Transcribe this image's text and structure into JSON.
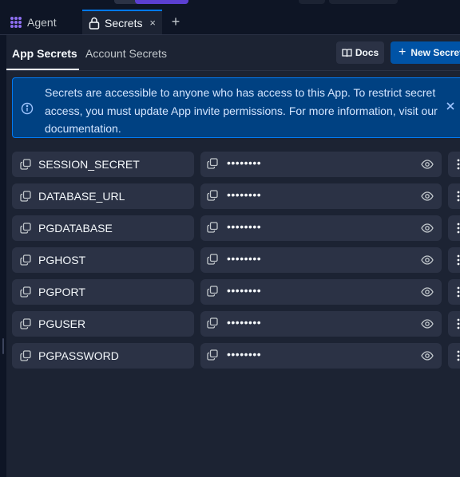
{
  "tabs": {
    "agent_label": "Agent",
    "secrets_label": "Secrets",
    "close_symbol": "×",
    "add_symbol": "+"
  },
  "subtabs": {
    "app": "App Secrets",
    "account": "Account Secrets"
  },
  "buttons": {
    "docs": "Docs",
    "new_secret": "New Secret"
  },
  "banner": {
    "message": "Secrets are accessible to anyone who has access to this App. To restrict secret access, you must update App invite permissions. For more information, visit our documentation."
  },
  "secrets": [
    {
      "key": "SESSION_SECRET",
      "value": "••••••••"
    },
    {
      "key": "DATABASE_URL",
      "value": "••••••••"
    },
    {
      "key": "PGDATABASE",
      "value": "••••••••"
    },
    {
      "key": "PGHOST",
      "value": "••••••••"
    },
    {
      "key": "PGPORT",
      "value": "••••••••"
    },
    {
      "key": "PGUSER",
      "value": "••••••••"
    },
    {
      "key": "PGPASSWORD",
      "value": "••••••••"
    }
  ],
  "colors": {
    "background": "#0e1525",
    "panel": "#1c2333",
    "field": "#2b3245",
    "accent": "#0079f2",
    "banner": "#004182"
  },
  "icons": {
    "agent": "agent-grid-icon",
    "secrets_tab": "lock-icon",
    "docs": "book-icon",
    "info": "info-icon",
    "copy": "copy-icon",
    "reveal": "eye-icon",
    "more": "more-vertical-icon"
  }
}
